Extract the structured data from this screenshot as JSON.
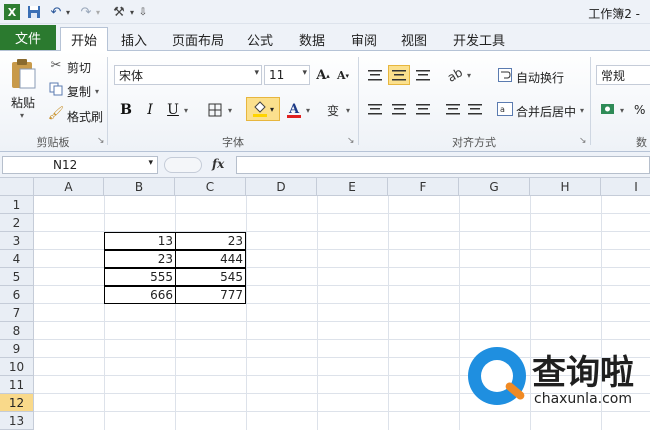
{
  "window": {
    "title": "工作簿2 -"
  },
  "quick_access": {
    "save_icon": "save-icon",
    "undo_icon": "undo-icon",
    "redo_icon": "redo-icon",
    "customize_icon": "tools-icon"
  },
  "tabs": {
    "file": "文件",
    "items": [
      "开始",
      "插入",
      "页面布局",
      "公式",
      "数据",
      "审阅",
      "视图",
      "开发工具"
    ],
    "active": "开始"
  },
  "ribbon": {
    "clipboard": {
      "paste": "粘贴",
      "cut": "剪切",
      "copy": "复制",
      "format_painter": "格式刷",
      "group_label": "剪贴板"
    },
    "font": {
      "font_name": "宋体",
      "font_size": "11",
      "bold": "B",
      "italic": "I",
      "underline": "U",
      "group_label": "字体"
    },
    "alignment": {
      "wrap_text": "自动换行",
      "merge_center": "合并后居中",
      "group_label": "对齐方式"
    },
    "number": {
      "format": "常规",
      "percent": "%",
      "group_label_partial": "数"
    }
  },
  "formula_bar": {
    "name_box": "N12",
    "fx": "fx",
    "value": ""
  },
  "sheet": {
    "columns": [
      "A",
      "B",
      "C",
      "D",
      "E",
      "F",
      "G",
      "H",
      "I"
    ],
    "rows": [
      "1",
      "2",
      "3",
      "4",
      "5",
      "6",
      "7",
      "8",
      "9",
      "10",
      "11",
      "12",
      "13"
    ],
    "selected_row": "12",
    "cells": {
      "B3": "13",
      "C3": "23",
      "B4": "23",
      "C4": "444",
      "B5": "555",
      "C5": "545",
      "B6": "666",
      "C6": "777"
    }
  },
  "watermark": {
    "text": "查询啦",
    "url": "chaxunla.com"
  },
  "colors": {
    "file_tab": "#2b7a2f",
    "selected_row_header": "#f9d98a",
    "highlight_btn": "#fbe08d",
    "font_color_bar": "#e02020",
    "fill_color_bar": "#ffd400"
  }
}
